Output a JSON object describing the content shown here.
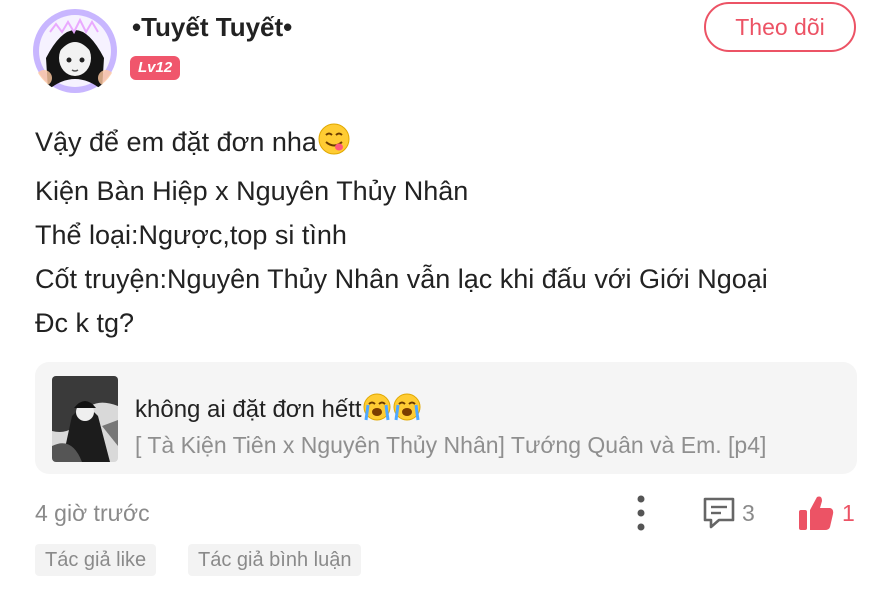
{
  "user": {
    "name": "•Tuyết Tuyết•",
    "level": "Lv12",
    "follow_label": "Theo dõi"
  },
  "post": {
    "lines": [
      "Vậy để em đặt đơn nha",
      "Kiện Bàn Hiệp x Nguyên Thủy Nhân",
      "Thể loại:Ngược,top si tình",
      "Cốt truyện:Nguyên Thủy Nhân vẫn lạc khi đấu với Giới Ngoại",
      "Đc k tg?"
    ],
    "emoji_icon": "yum-face-icon"
  },
  "quote": {
    "title": "không ai đặt đơn hếtt",
    "subtitle": "[ Tà Kiện Tiên x Nguyên Thủy Nhân] Tướng Quân và Em. [p4]",
    "emoji_icon": "loudly-crying-face-icon"
  },
  "footer": {
    "time": "4 giờ trước",
    "comment_count": "3",
    "like_count": "1"
  },
  "tags": [
    "Tác giả like",
    "Tác giả bình luận"
  ],
  "colors": {
    "accent": "#ec5365",
    "muted": "#8a8a8a",
    "quote_bg": "#f5f5f5"
  }
}
